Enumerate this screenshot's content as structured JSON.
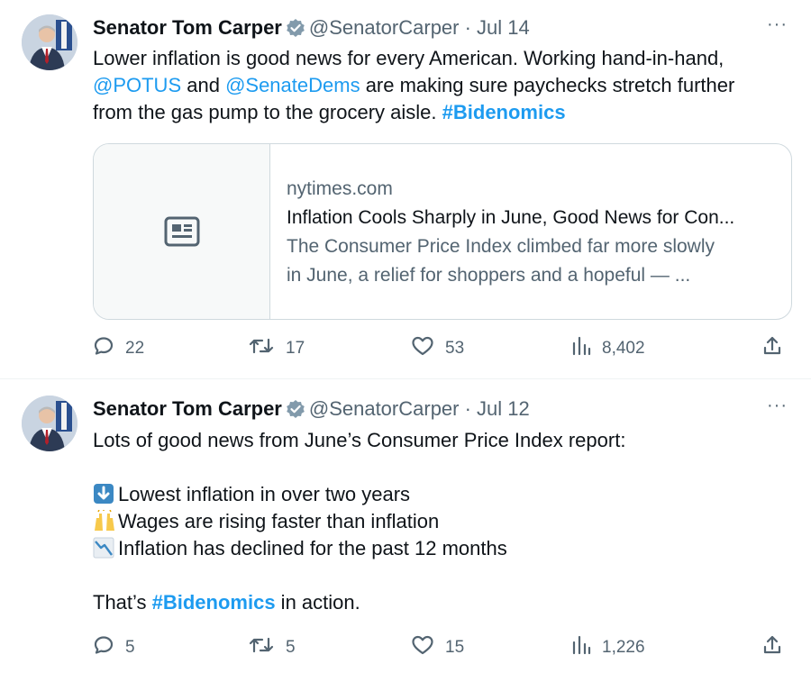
{
  "tweets": [
    {
      "name": "Senator Tom Carper",
      "handle": "@SenatorCarper · Jul 14",
      "text_parts": {
        "p1": "Lower inflation is good news for every American. Working hand-in-hand,",
        "mention1": "@POTUS",
        "p2": " and ",
        "mention2": "@SenateDems",
        "p3": " are making sure paychecks stretch further",
        "p4": "from the gas pump to the grocery aisle. ",
        "hashtag": "#Bidenomics"
      },
      "card": {
        "domain": "nytimes.com",
        "title": "Inflation Cools Sharply in June, Good News for Con...",
        "desc_line1": "The Consumer Price Index climbed far more slowly",
        "desc_line2": "in June, a relief for shoppers and a hopeful — ..."
      },
      "stats": {
        "replies": "22",
        "retweets": "17",
        "likes": "53",
        "views": "8,402"
      }
    },
    {
      "name": "Senator Tom Carper",
      "handle": "@SenatorCarper · Jul 12",
      "text_parts": {
        "line1": "Lots of good news from June’s Consumer Price Index report:",
        "bullet1": "Lowest inflation in over two years",
        "bullet2": "Wages are rising faster than inflation",
        "bullet3": "Inflation has declined for the past 12 months",
        "closing_pre": "That’s ",
        "hashtag": "#Bidenomics",
        "closing_post": " in action."
      },
      "stats": {
        "replies": "5",
        "retweets": "5",
        "likes": "15",
        "views": "1,226"
      }
    }
  ],
  "more_label": "···",
  "icons": {
    "verified": "verified-badge-icon",
    "reply": "reply-icon",
    "retweet": "retweet-icon",
    "like": "heart-icon",
    "views": "views-bar-chart-icon",
    "share": "share-icon",
    "card": "news-article-icon",
    "bullet1": "down-arrow-emoji-icon",
    "bullet2": "raised-hands-emoji-icon",
    "bullet3": "chart-decreasing-emoji-icon"
  },
  "colors": {
    "link": "#1d9bf0",
    "muted": "#536471",
    "border": "#cfd9de"
  }
}
